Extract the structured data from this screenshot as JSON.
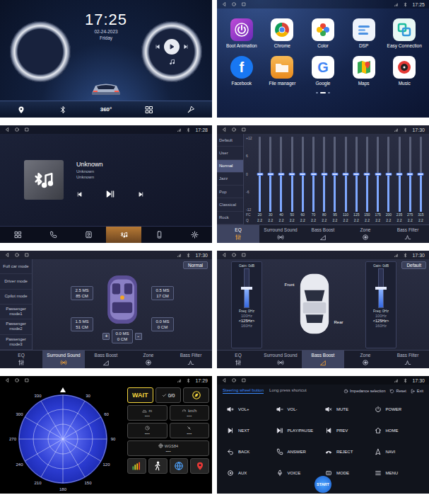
{
  "home": {
    "time": "17:25",
    "date": "02-24-2023",
    "weekday": "Friday",
    "dock_label": "360°"
  },
  "apps": {
    "status_time": "17:25",
    "items": [
      {
        "label": "Boot Animation"
      },
      {
        "label": "Chrome"
      },
      {
        "label": "Color"
      },
      {
        "label": "DSP"
      },
      {
        "label": "Easy Connection"
      },
      {
        "label": "Facebook",
        "icon_text": "f"
      },
      {
        "label": "File manager"
      },
      {
        "label": "Google",
        "icon_text": "G"
      },
      {
        "label": "Maps"
      },
      {
        "label": "Music"
      }
    ],
    "page_dots": [
      {
        "selected": false
      },
      {
        "selected": true
      },
      {
        "selected": false
      }
    ]
  },
  "bt_music": {
    "status_time": "17:28",
    "title": "Unknown",
    "artist": "Unknown",
    "album": "Unknown",
    "nav": [
      {
        "selected": false
      },
      {
        "selected": false
      },
      {
        "selected": false
      },
      {
        "selected": true
      },
      {
        "selected": false
      },
      {
        "selected": false
      }
    ]
  },
  "eq": {
    "status_time": "17:30",
    "presets": [
      {
        "label": "Default",
        "selected": false
      },
      {
        "label": "User",
        "selected": false
      },
      {
        "label": "Normal",
        "selected": true
      },
      {
        "label": "Jazz",
        "selected": false
      },
      {
        "label": "Pop",
        "selected": false
      },
      {
        "label": "Classical",
        "selected": false
      },
      {
        "label": "Rock",
        "selected": false
      }
    ],
    "y_ticks": [
      "+12",
      "6",
      "0",
      "-6",
      "-12"
    ],
    "fc_label": "FC",
    "q_label": "Q",
    "bands": [
      {
        "fc": "20",
        "q": "2.2",
        "level": 0.5
      },
      {
        "fc": "30",
        "q": "2.2",
        "level": 0.5
      },
      {
        "fc": "40",
        "q": "2.2",
        "level": 0.5
      },
      {
        "fc": "50",
        "q": "2.2",
        "level": 0.5
      },
      {
        "fc": "60",
        "q": "2.2",
        "level": 0.5
      },
      {
        "fc": "70",
        "q": "2.2",
        "level": 0.5
      },
      {
        "fc": "80",
        "q": "2.2",
        "level": 0.5
      },
      {
        "fc": "95",
        "q": "2.2",
        "level": 0.5
      },
      {
        "fc": "110",
        "q": "2.2",
        "level": 0.5
      },
      {
        "fc": "125",
        "q": "2.2",
        "level": 0.5
      },
      {
        "fc": "150",
        "q": "2.2",
        "level": 0.5
      },
      {
        "fc": "175",
        "q": "2.2",
        "level": 0.5
      },
      {
        "fc": "200",
        "q": "2.2",
        "level": 0.5
      },
      {
        "fc": "235",
        "q": "2.2",
        "level": 0.5
      },
      {
        "fc": "275",
        "q": "2.2",
        "level": 0.5
      },
      {
        "fc": "315",
        "q": "2.2",
        "level": 0.5
      }
    ],
    "tabs": [
      {
        "label": "EQ",
        "selected": true
      },
      {
        "label": "Surround Sound",
        "selected": false
      },
      {
        "label": "Bass Boost",
        "selected": false
      },
      {
        "label": "Zone",
        "selected": false
      },
      {
        "label": "Bass Filter",
        "selected": false
      }
    ]
  },
  "surround": {
    "status_time": "17:30",
    "modes": [
      {
        "label": "Full car mode"
      },
      {
        "label": "Driver mode"
      },
      {
        "label": "Cpilot mode"
      },
      {
        "label": "Passenger mode1"
      },
      {
        "label": "Passenger mode2"
      },
      {
        "label": "Passenger mode3"
      }
    ],
    "preset": "Normal",
    "delays": [
      {
        "ms": "2.5 MS",
        "cm": "85 CM"
      },
      {
        "ms": "0.5 MS",
        "cm": "17 CM"
      },
      {
        "ms": "1.5 MS",
        "cm": "51 CM"
      },
      {
        "ms": "0.0 MS",
        "cm": "0 CM"
      }
    ],
    "center": {
      "plus": "+",
      "ms": "0.0 MS",
      "cm": "0 CM",
      "minus": "-"
    },
    "tabs": [
      {
        "label": "EQ",
        "selected": false
      },
      {
        "label": "Surround Sound",
        "selected": true
      },
      {
        "label": "Bass Boost",
        "selected": false
      },
      {
        "label": "Zone",
        "selected": false
      },
      {
        "label": "Bass Filter",
        "selected": false
      }
    ]
  },
  "bass_boost": {
    "status_time": "17:30",
    "preset": "Default",
    "front_label": "Front",
    "rear_label": "Rear",
    "sliders": [
      {
        "gain": "Gain: 0dB",
        "freq": "Freq: 0Hz",
        "level": 0.5,
        "options": [
          {
            "label": "100Hz",
            "selected": false
          },
          {
            "label": "<125Hz>",
            "selected": true
          },
          {
            "label": "160Hz",
            "selected": false
          }
        ]
      },
      {
        "gain": "Gain: 0dB",
        "freq": "Freq: 0Hz",
        "level": 0.5,
        "options": [
          {
            "label": "100Hz",
            "selected": false
          },
          {
            "label": "<125Hz>",
            "selected": true
          },
          {
            "label": "160Hz",
            "selected": false
          }
        ]
      }
    ],
    "tabs": [
      {
        "label": "EQ",
        "selected": false
      },
      {
        "label": "Surround Sound",
        "selected": false
      },
      {
        "label": "Bass Boost",
        "selected": true
      },
      {
        "label": "Zone",
        "selected": false
      },
      {
        "label": "Bass Filter",
        "selected": false
      }
    ]
  },
  "gps": {
    "status_time": "17:29",
    "degrees": [
      "30",
      "60",
      "90",
      "120",
      "150",
      "180",
      "210",
      "240",
      "270",
      "300",
      "330"
    ],
    "wait": "WAIT",
    "count": "0/0",
    "cells": [
      {
        "label": "m",
        "value": "---"
      },
      {
        "label": "km/h",
        "value": "---"
      },
      {
        "value": "---"
      },
      {
        "value": "---"
      }
    ],
    "datum": {
      "label": "WGS84",
      "value": "---"
    }
  },
  "steering": {
    "status_time": "17:30",
    "tabs": [
      {
        "label": "Steering wheel button",
        "selected": true
      },
      {
        "label": "Long press shortcut",
        "selected": false
      }
    ],
    "actions": [
      {
        "label": "Impedance selection"
      },
      {
        "label": "Reset"
      },
      {
        "label": "Exit"
      }
    ],
    "keys": [
      {
        "label": "VOL+"
      },
      {
        "label": "VOL-"
      },
      {
        "label": "MUTE"
      },
      {
        "label": "POWER"
      },
      {
        "label": "NEXT"
      },
      {
        "label": "PLAY/PAUSE"
      },
      {
        "label": "PREV"
      },
      {
        "label": "HOME"
      },
      {
        "label": "BACK"
      },
      {
        "label": "ANSWER"
      },
      {
        "label": "REJECT"
      },
      {
        "label": "NAVI"
      },
      {
        "label": "AUX"
      },
      {
        "label": "VOICE"
      },
      {
        "label": "MODE"
      },
      {
        "label": "MENU"
      }
    ],
    "start": "START"
  }
}
